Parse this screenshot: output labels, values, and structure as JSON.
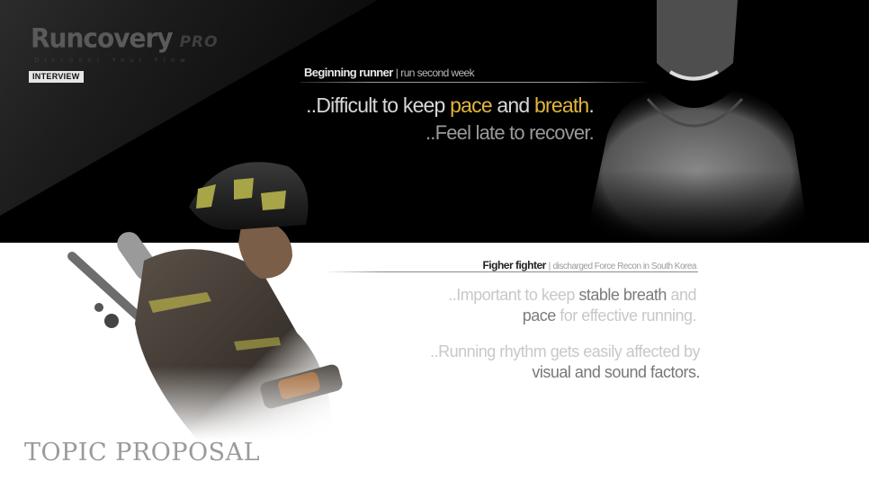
{
  "brand": {
    "name": "Runcovery",
    "edition": "PRO",
    "tagline": "Discover Your Flow"
  },
  "badge": "INTERVIEW",
  "interview_1": {
    "title": "Beginning runner",
    "separator": "|",
    "subtitle": "run second week",
    "line1_a": "..Difficult to keep ",
    "line1_hl1": "pace",
    "line1_b": " and ",
    "line1_hl2": "breath",
    "line1_c": ".",
    "line2": "..Feel late to recover."
  },
  "interview_2": {
    "title": "Figher fighter",
    "separator": "|",
    "subtitle": "discharged Force  Recon in South Korea",
    "q1_a": "..Important to keep ",
    "q1_b": "stable breath",
    "q1_c": " and",
    "q1_d": "pace",
    "q1_e": " for effective running.",
    "q2_a": "..Running rhythm gets easily affected by",
    "q2_b": "visual and sound factors."
  },
  "footer_title": "TOPIC PROPOSAL",
  "colors": {
    "accent_yellow": "#e2b63c",
    "top_background": "#000000",
    "page_background": "#ffffff"
  }
}
